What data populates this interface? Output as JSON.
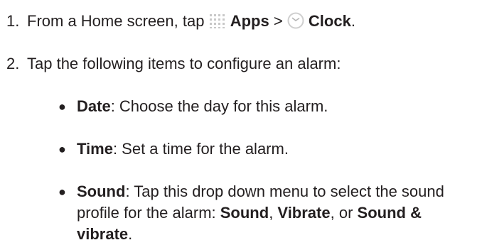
{
  "steps": [
    {
      "number": "1.",
      "pre": "From a Home screen, tap",
      "apps_label": "Apps",
      "separator": ">",
      "clock_label": "Clock",
      "end": "."
    },
    {
      "number": "2.",
      "text": "Tap the following items to configure an alarm:"
    }
  ],
  "bullets": [
    {
      "term": "Date",
      "desc": ": Choose the day for this alarm."
    },
    {
      "term": "Time",
      "desc": ": Set a time for the alarm."
    },
    {
      "term": "Sound",
      "desc": ": Tap this drop down menu to select the sound profile for the alarm: ",
      "opt1": "Sound",
      "sep1": ", ",
      "opt2": "Vibrate",
      "sep2": ", or",
      "opt3": "Sound & vibrate",
      "end": "."
    }
  ],
  "colors": {
    "text": "#231f20",
    "apps_icon": "#c8c8c8",
    "clock_icon": "#cfcfcf"
  },
  "icons": {
    "apps": "apps-grid-icon",
    "clock": "clock-icon"
  }
}
